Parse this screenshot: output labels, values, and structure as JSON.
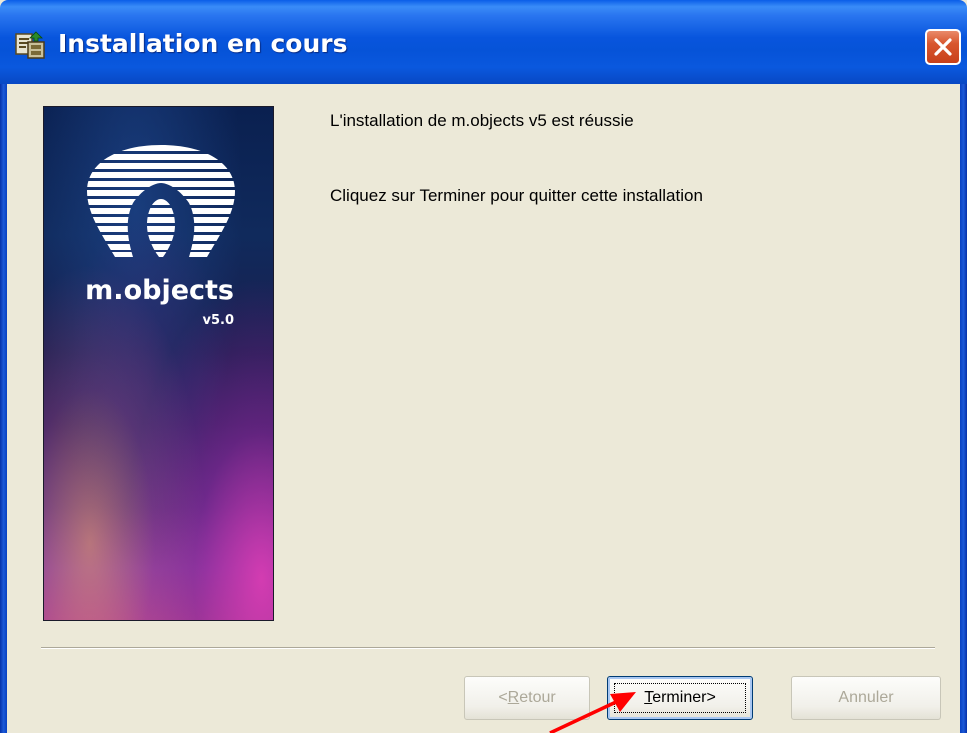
{
  "window": {
    "title": "Installation en cours",
    "title_icon": "installer-icon",
    "close_icon": "close-icon"
  },
  "banner": {
    "brand": "m.objects",
    "version": "v5.0",
    "logo_icon": "m-objects-logo-icon"
  },
  "content": {
    "line1": "L'installation de m.objects v5 est réussie",
    "line2": "Cliquez sur Terminer pour quitter cette installation"
  },
  "buttons": {
    "back": {
      "prefix": "<",
      "accel": "R",
      "rest": "etour",
      "enabled": false
    },
    "finish": {
      "accel": "T",
      "rest": "erminer>",
      "enabled": true,
      "focused": true
    },
    "cancel": {
      "label": "Annuler",
      "enabled": false
    }
  },
  "annotation": {
    "arrow_icon": "red-arrow-icon",
    "arrow_color": "#ff0000"
  }
}
